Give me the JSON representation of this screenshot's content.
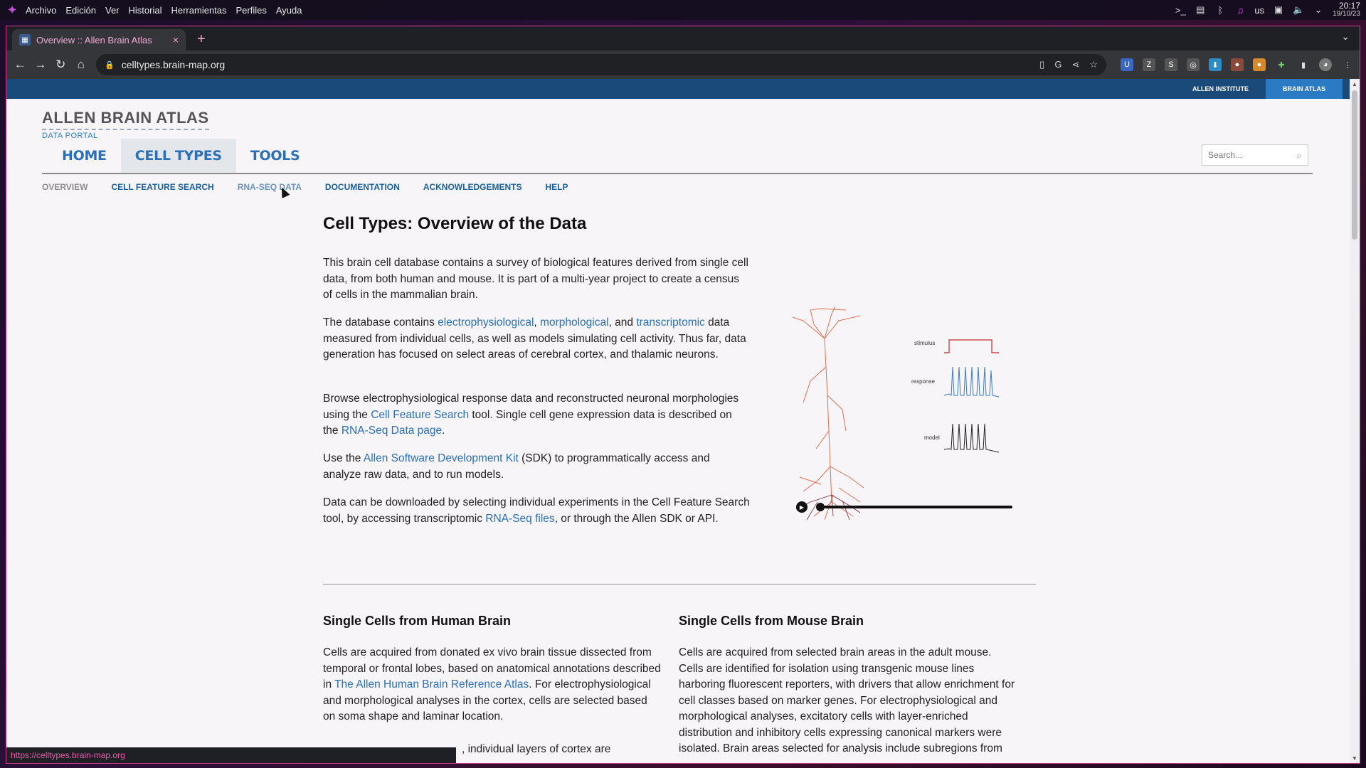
{
  "os": {
    "menu": [
      "Archivo",
      "Edición",
      "Ver",
      "Historial",
      "Herramientas",
      "Perfiles",
      "Ayuda"
    ],
    "keyboard_layout": "us",
    "time": "20:17",
    "date": "19/10/23"
  },
  "browser": {
    "tab_title": "Overview :: Allen Brain Atlas",
    "url": "celltypes.brain-map.org",
    "status_url": "https://celltypes.brain-map.org"
  },
  "site": {
    "top_links": [
      "ALLEN INSTITUTE",
      "BRAIN ATLAS"
    ],
    "logo_main": "ALLEN BRAIN ATLAS",
    "logo_sub": "DATA PORTAL",
    "main_nav": [
      "HOME",
      "CELL TYPES",
      "TOOLS"
    ],
    "search_placeholder": "Search...",
    "sub_nav": [
      "OVERVIEW",
      "CELL FEATURE SEARCH",
      "RNA-SEQ DATA",
      "DOCUMENTATION",
      "ACKNOWLEDGEMENTS",
      "HELP"
    ]
  },
  "content": {
    "title": "Cell Types: Overview of the Data",
    "p1": "This brain cell database contains a survey of biological features derived from single cell data, from both human and mouse. It is part of a multi-year project to create a census of cells in the mammalian brain.",
    "p2": {
      "pre": "The database contains ",
      "link1": "electrophysiological",
      "sep1": ", ",
      "link2": "morphological",
      "sep2": ", and ",
      "link3": "transcriptomic",
      "post": " data measured from individual cells, as well as models simulating cell activity. Thus far, data generation has focused on select areas of cerebral cortex, and thalamic neurons."
    },
    "p3": {
      "pre": "Browse electrophysiological response data and reconstructed neuronal morphologies using the ",
      "link1": "Cell Feature Search",
      "mid": " tool. Single cell gene expression data is described on the ",
      "link2": "RNA-Seq Data page",
      "post": "."
    },
    "p4": {
      "pre": "Use the ",
      "link": "Allen Software Development Kit",
      "post": " (SDK) to programmatically access and analyze raw data, and to run models."
    },
    "p5": {
      "pre": "Data can be downloaded by selecting individual experiments in the Cell Feature Search tool, by accessing transcriptomic ",
      "link": "RNA-Seq files",
      "post": ", or through the Allen SDK or API."
    },
    "figure_labels": [
      "stimulus",
      "response",
      "model"
    ],
    "human": {
      "heading": "Single Cells from Human Brain",
      "pre": "Cells are acquired from donated ex vivo brain tissue dissected from temporal or frontal lobes, based on anatomical annotations described in ",
      "link": "The Allen Human Brain Reference Atlas",
      "post": ". For electrophysiological and morphological analyses in the cortex, cells are selected based on soma shape and laminar location.",
      "cut_line": ", individual layers of cortex are"
    },
    "mouse": {
      "heading": "Single Cells from Mouse Brain",
      "text": "Cells are acquired from selected brain areas in the adult mouse. Cells are identified for isolation using transgenic mouse lines harboring fluorescent reporters, with drivers that allow enrichment for cell classes based on marker genes. For electrophysiological and morphological analyses, excitatory cells with layer-enriched distribution and inhibitory cells expressing canonical markers were isolated. Brain areas selected for analysis include subregions from"
    }
  },
  "colors": {
    "link": "#2b6fb8",
    "top_strip": "#1a4a7a",
    "active_top_link": "#2b7bc4",
    "tab_text": "#f2a9d6"
  }
}
